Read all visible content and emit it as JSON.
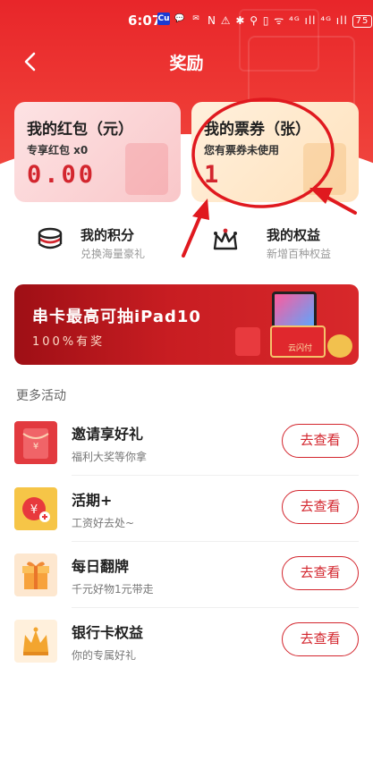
{
  "status_bar": {
    "time": "6:07",
    "app_icons": [
      "Cu",
      "💬",
      "✉"
    ],
    "system_icons": "N ⚠ ✱ ⚲ ▯ ᯤ ⁴ᴳ ıll ⁴ᴳ ıll",
    "battery": "75"
  },
  "nav": {
    "title": "奖励"
  },
  "cards": {
    "red_packet": {
      "title": "我的红包（元）",
      "subtitle": "专享红包 x0",
      "value": "0.00"
    },
    "tickets": {
      "title": "我的票券（张）",
      "subtitle": "您有票券未使用",
      "value": "1"
    }
  },
  "points": {
    "title": "我的积分",
    "subtitle": "兑换海量豪礼"
  },
  "rights": {
    "title": "我的权益",
    "subtitle": "新增百种权益"
  },
  "banner": {
    "title": "串卡最高可抽iPad10",
    "subtitle": "100%有奖",
    "tag": "云闪付"
  },
  "more_label": "更多活动",
  "activities": [
    {
      "title": "邀请享好礼",
      "subtitle": "福利大奖等你拿",
      "button": "去查看",
      "icon": "red-envelope-icon"
    },
    {
      "title": "活期+",
      "subtitle": "工资好去处~",
      "button": "去查看",
      "icon": "yuan-coin-icon"
    },
    {
      "title": "每日翻牌",
      "subtitle": "千元好物1元带走",
      "button": "去查看",
      "icon": "gift-box-icon"
    },
    {
      "title": "银行卡权益",
      "subtitle": "你的专属好礼",
      "button": "去查看",
      "icon": "crown-icon"
    }
  ],
  "colors": {
    "primary_red": "#d3262e",
    "header_red": "#ec3330",
    "annotation": "#e0191f"
  }
}
